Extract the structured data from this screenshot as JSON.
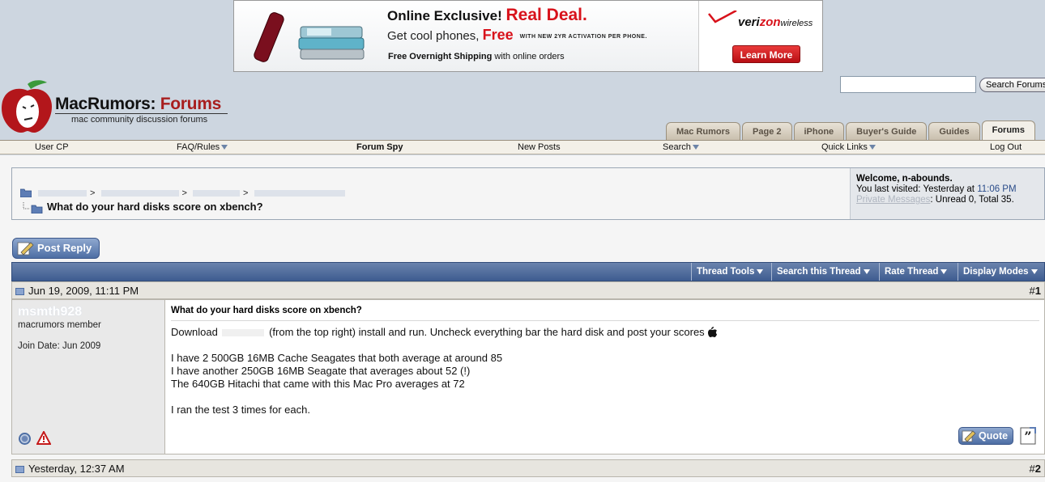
{
  "ad": {
    "line1_a": "Online Exclusive",
    "line1_b": "!",
    "line1_c": "Real Deal.",
    "line2_a": "Get cool phones,",
    "line2_b": "Free",
    "line2_c": "WITH NEW 2YR ACTIVATION PER PHONE.",
    "line3_a": "Free Overnight Shipping",
    "line3_b": "with online orders",
    "brand_a": "veri",
    "brand_b": "zon",
    "brand_c": "wireless",
    "cta": "Learn More"
  },
  "search": {
    "button_label": "Search Forums"
  },
  "logo": {
    "title_a": "MacRumors",
    "title_b": ":",
    "title_c": "Forums",
    "subtitle": "mac community discussion forums"
  },
  "tabs": [
    {
      "label": "Mac Rumors"
    },
    {
      "label": "Page 2"
    },
    {
      "label": "iPhone"
    },
    {
      "label": "Buyer's Guide"
    },
    {
      "label": "Guides"
    },
    {
      "label": "Forums"
    }
  ],
  "nav": {
    "user_cp": "User CP",
    "faq": "FAQ/Rules",
    "forum_spy": "Forum Spy",
    "new_posts": "New Posts",
    "search": "Search",
    "quick_links": "Quick Links",
    "log_out": "Log Out"
  },
  "breadcrumb": {
    "separator": ">",
    "thread_title": "What do your hard disks score on xbench?"
  },
  "welcome": {
    "greeting": "Welcome, n-abounds.",
    "last_visited_prefix": "You last visited: Yesterday at",
    "last_visited_time": "11:06 PM",
    "pm_link": "Private Messages",
    "pm_counts": ": Unread 0, Total 35."
  },
  "post_reply_label": "Post Reply",
  "thread_bar": {
    "thread_tools": "Thread Tools",
    "search_thread": "Search this Thread",
    "rate_thread": "Rate Thread",
    "display_modes": "Display Modes"
  },
  "posts": [
    {
      "date": "Jun 19, 2009, 11:11 PM",
      "number_prefix": "#",
      "number": "1",
      "username": "msmth928",
      "rank": "macrumors member",
      "join_date": "Join Date: Jun 2009",
      "title": "What do your hard disks score on xbench?",
      "body_download": "Download",
      "body_download_rest": "(from the top right) install and run. Uncheck everything bar the hard disk and post your scores",
      "body_lines": [
        "I have 2 500GB 16MB Cache Seagates that both average at around 85",
        "I have another 250GB 16MB Seagate that averages about 52 (!)",
        "The 640GB Hitachi that came with this Mac Pro averages at 72"
      ],
      "body_last": "I ran the test 3 times for each.",
      "quote_label": "Quote"
    },
    {
      "date": "Yesterday, 12:37 AM",
      "number_prefix": "#",
      "number": "2"
    }
  ],
  "colors": {
    "page_bg": "#cdd6e0",
    "accent_blue": "#3e5c90",
    "brand_red": "#a81e1e",
    "verizon_red": "#d8121b"
  }
}
